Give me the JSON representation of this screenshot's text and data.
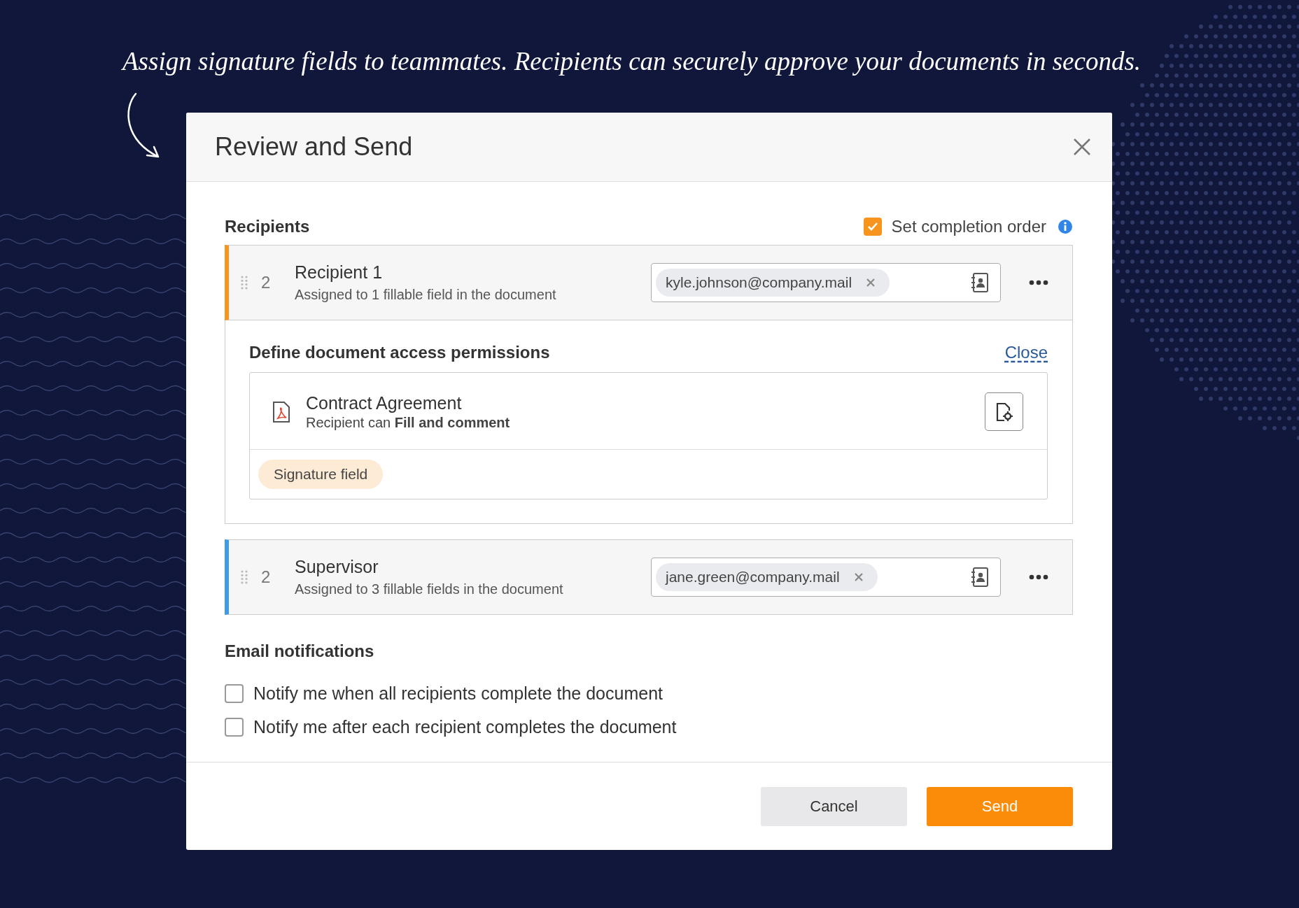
{
  "headline": "Assign signature fields to teammates. Recipients can securely approve your documents in seconds.",
  "dialog": {
    "title": "Review and Send"
  },
  "recipients_section": {
    "heading": "Recipients",
    "completion_order": {
      "label": "Set completion order",
      "checked": true
    }
  },
  "recipients": [
    {
      "name": "Recipient 1",
      "order": "2",
      "summary": "Assigned to 1 fillable field in the document",
      "email": "kyle.johnson@company.mail",
      "color": "#f7941d",
      "expanded": true,
      "permissions": {
        "heading": "Define document access permissions",
        "close_link": "Close",
        "document": {
          "name": "Contract Agreement",
          "access": "Recipient can **Fill and comment**"
        },
        "fields": [
          "Signature field"
        ]
      }
    },
    {
      "name": "Supervisor",
      "order": "2",
      "summary": "Assigned to 3 fillable fields in the document",
      "email": "jane.green@company.mail",
      "color": "#3d9be9",
      "expanded": false
    }
  ],
  "email_notifications": {
    "heading": "Email notifications",
    "options": [
      {
        "label": "Notify me when all recipients complete the document",
        "checked": false
      },
      {
        "label": "Notify me after each recipient completes the document",
        "checked": false
      }
    ]
  },
  "buttons": [
    {
      "label": "Cancel",
      "kind": "secondary"
    },
    {
      "label": "Send",
      "kind": "primary"
    }
  ]
}
